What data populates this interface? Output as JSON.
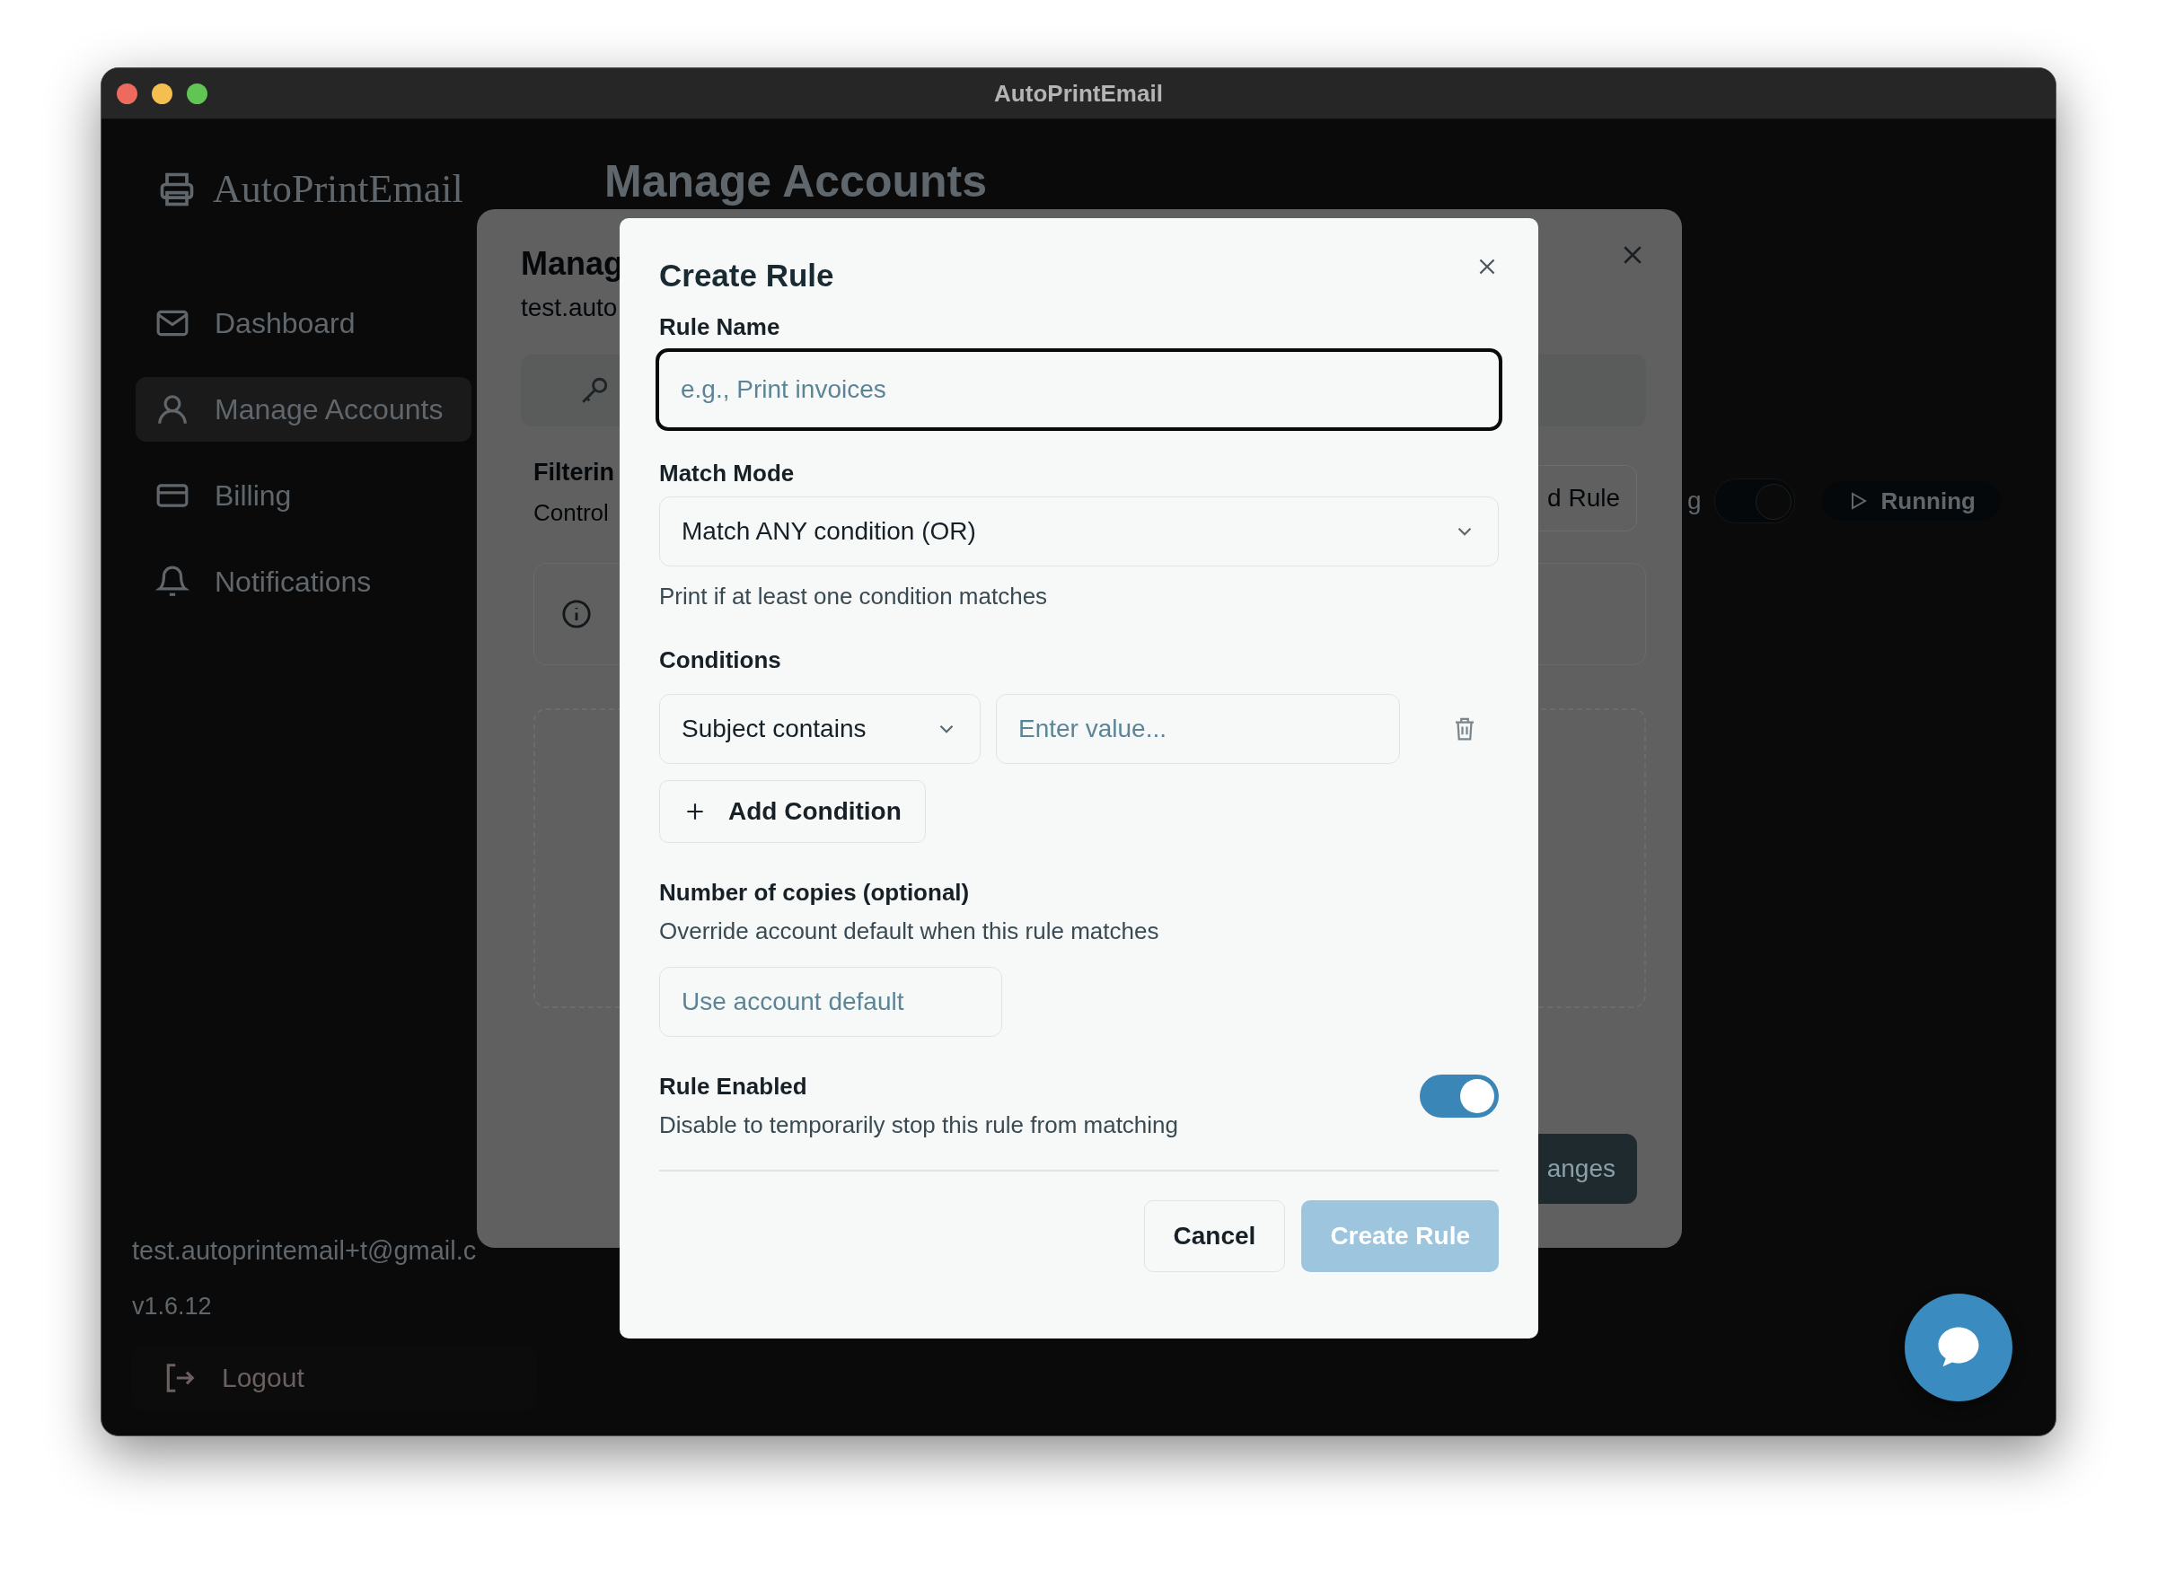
{
  "window": {
    "title": "AutoPrintEmail"
  },
  "sidebar": {
    "logo": "AutoPrintEmail",
    "items": [
      {
        "label": "Dashboard",
        "kind": "mail",
        "selected": false
      },
      {
        "label": "Manage Accounts",
        "kind": "user",
        "selected": true
      },
      {
        "label": "Billing",
        "kind": "card",
        "selected": false
      },
      {
        "label": "Notifications",
        "kind": "bell",
        "selected": false
      }
    ],
    "user_email": "test.autoprintemail+t@gmail.c",
    "version": "v1.6.12",
    "logout": "Logout"
  },
  "page_title": "Manage Accounts",
  "status": {
    "label": "g",
    "on": true,
    "badge": "Running"
  },
  "account_dialog": {
    "title": "Manag",
    "subtitle": "test.auto",
    "section_title": "Filterin",
    "section_text": "Control",
    "add_rule": "d Rule",
    "save": "anges"
  },
  "modal": {
    "title": "Create Rule",
    "rule_name": {
      "label": "Rule Name",
      "placeholder": "e.g., Print invoices",
      "focused": true
    },
    "match_mode": {
      "label": "Match Mode",
      "value": "Match ANY condition (OR)",
      "hint": "Print if at least one condition matches"
    },
    "conditions": {
      "label": "Conditions",
      "rows": [
        {
          "field": "Subject contains",
          "placeholder": "Enter value..."
        }
      ],
      "add": "Add Condition"
    },
    "copies": {
      "label": "Number of copies (optional)",
      "hint": "Override account default when this rule matches",
      "placeholder": "Use account default"
    },
    "enabled": {
      "label": "Rule Enabled",
      "hint": "Disable to temporarily stop this rule from matching",
      "on": true
    },
    "cancel": "Cancel",
    "submit": {
      "label": "Create Rule",
      "disabled": true
    }
  }
}
